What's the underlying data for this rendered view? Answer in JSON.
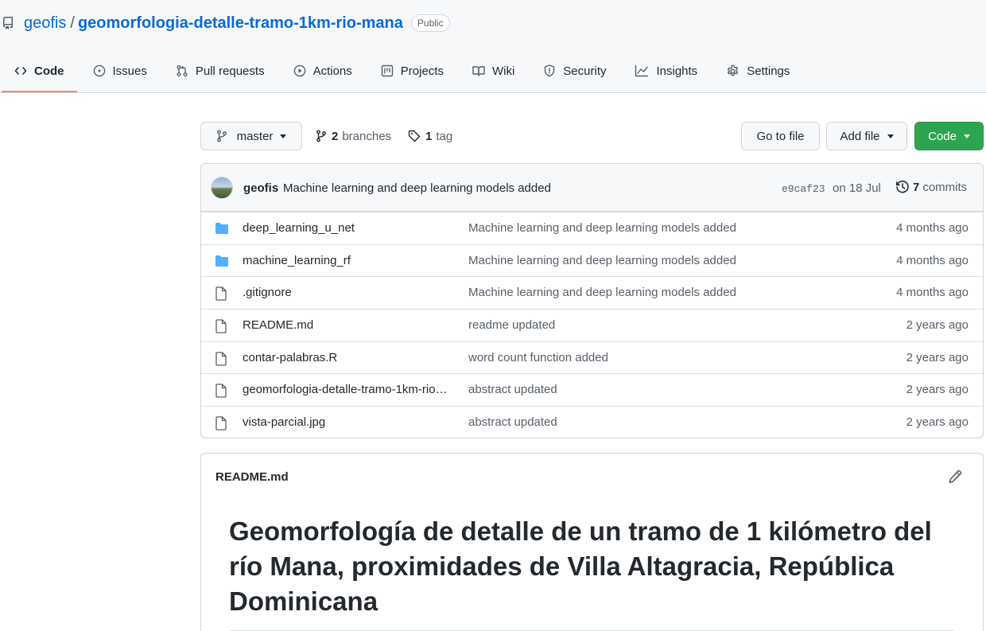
{
  "repo": {
    "owner": "geofis",
    "separator": "/",
    "name": "geomorfologia-detalle-tramo-1km-rio-mana",
    "visibility": "Public"
  },
  "tabs": [
    {
      "label": "Code",
      "icon": "code-icon",
      "active": true
    },
    {
      "label": "Issues",
      "icon": "issue-icon"
    },
    {
      "label": "Pull requests",
      "icon": "pull-request-icon"
    },
    {
      "label": "Actions",
      "icon": "play-icon"
    },
    {
      "label": "Projects",
      "icon": "project-icon"
    },
    {
      "label": "Wiki",
      "icon": "book-icon"
    },
    {
      "label": "Security",
      "icon": "shield-icon"
    },
    {
      "label": "Insights",
      "icon": "graph-icon"
    },
    {
      "label": "Settings",
      "icon": "gear-icon"
    }
  ],
  "toolbar": {
    "branch": "master",
    "branches_count": "2",
    "branches_label": "branches",
    "tags_count": "1",
    "tags_label": "tag",
    "go_to_file": "Go to file",
    "add_file": "Add file",
    "code": "Code"
  },
  "latest_commit": {
    "author": "geofis",
    "message": "Machine learning and deep learning models added",
    "sha": "e9caf23",
    "date": "on 18 Jul",
    "commits_count": "7",
    "commits_label": "commits"
  },
  "files": [
    {
      "name": "deep_learning_u_net",
      "type": "folder",
      "message": "Machine learning and deep learning models added",
      "age": "4 months ago"
    },
    {
      "name": "machine_learning_rf",
      "type": "folder",
      "message": "Machine learning and deep learning models added",
      "age": "4 months ago"
    },
    {
      "name": ".gitignore",
      "type": "file",
      "message": "Machine learning and deep learning models added",
      "age": "4 months ago"
    },
    {
      "name": "README.md",
      "type": "file",
      "message": "readme updated",
      "age": "2 years ago"
    },
    {
      "name": "contar-palabras.R",
      "type": "file",
      "message": "word count function added",
      "age": "2 years ago"
    },
    {
      "name": "geomorfologia-detalle-tramo-1km-rio…",
      "type": "file",
      "message": "abstract updated",
      "age": "2 years ago"
    },
    {
      "name": "vista-parcial.jpg",
      "type": "file",
      "message": "abstract updated",
      "age": "2 years ago"
    }
  ],
  "readme": {
    "filename": "README.md",
    "heading": "Geomorfología de detalle de un tramo de 1 kilómetro del río Mana, proximidades de Villa Altagracia, República Dominicana"
  },
  "colors": {
    "link": "#0969da",
    "active_tab_underline": "#fd8c73",
    "primary_button": "#2da44e",
    "folder": "#54aeff"
  }
}
